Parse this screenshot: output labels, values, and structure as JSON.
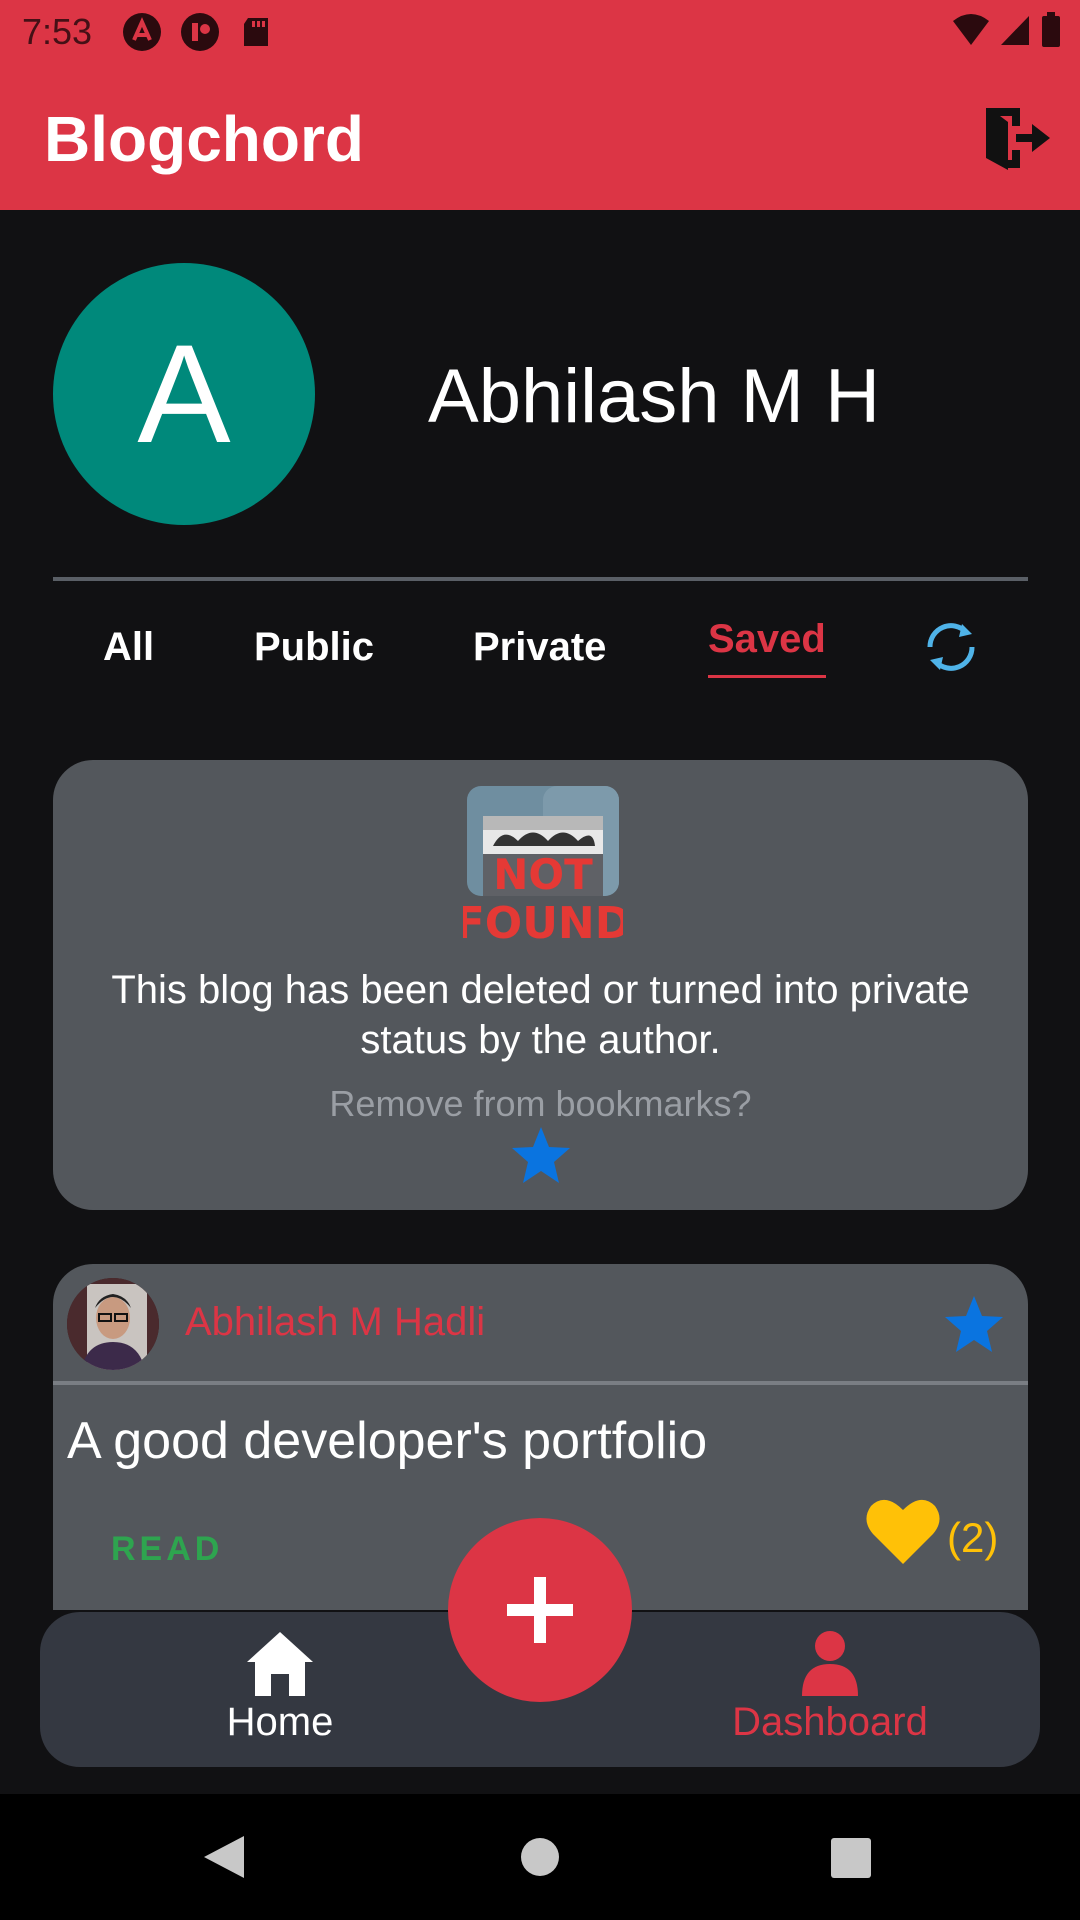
{
  "status_bar": {
    "time": "7:53",
    "icons": [
      "angular-notification-icon",
      "app-notification-icon",
      "sd-card-icon",
      "wifi-icon",
      "cell-signal-icon",
      "battery-icon"
    ]
  },
  "app_bar": {
    "title": "Blogchord",
    "logout_icon": "logout-icon"
  },
  "profile": {
    "avatar_letter": "A",
    "avatar_color": "#00897b",
    "name": "Abhilash M H"
  },
  "tabs": [
    {
      "label": "All",
      "active": false
    },
    {
      "label": "Public",
      "active": false
    },
    {
      "label": "Private",
      "active": false
    },
    {
      "label": "Saved",
      "active": true
    }
  ],
  "refresh_icon": "refresh-icon",
  "deleted_card": {
    "image_text": [
      "NOT",
      "FOUND"
    ],
    "message": "This blog has been deleted or turned into private status by the author.",
    "remove_prompt": "Remove from bookmarks?",
    "star_icon": "star-icon"
  },
  "blog_card": {
    "author_name": "Abhilash M Hadli",
    "title": "A good developer's portfolio",
    "read_label": "READ",
    "like_count": "(2)",
    "bookmarked": true
  },
  "bottom_nav": {
    "home_label": "Home",
    "dashboard_label": "Dashboard",
    "active": "Dashboard"
  },
  "colors": {
    "primary": "#dc3545",
    "card": "#53575c",
    "bookmark_star": "#0a74e0",
    "like": "#ffc107",
    "read": "#2ea44f",
    "refresh": "#4fb3e8"
  }
}
